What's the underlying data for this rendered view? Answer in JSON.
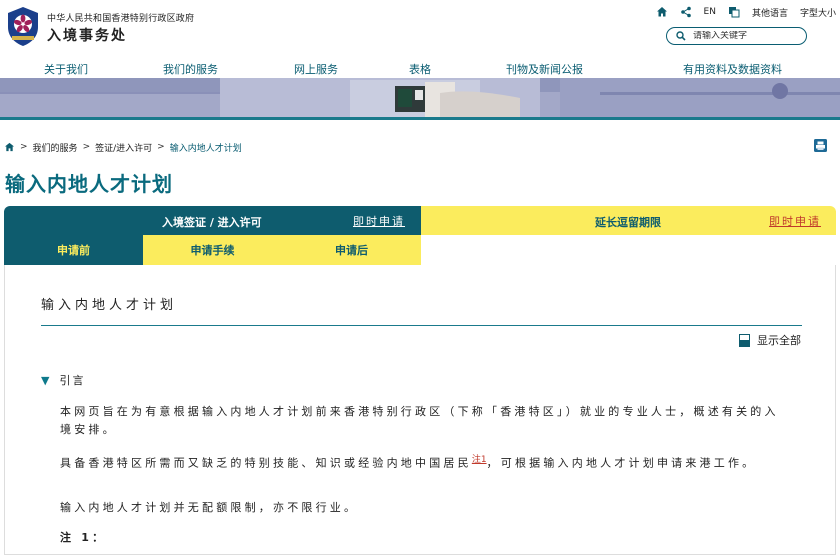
{
  "header": {
    "gov_name": "中华人民共和国香港特别行政区政府",
    "dept_name": "入境事务处",
    "utilities": {
      "en": "EN",
      "other_lang": "其他语言",
      "font_size": "字型大小"
    },
    "search": {
      "placeholder": "请输入关键字"
    }
  },
  "nav": {
    "items": [
      "关于我们",
      "我们的服务",
      "网上服务",
      "表格",
      "刊物及新闻公报",
      "有用资料及数据资料"
    ]
  },
  "breadcrumb": {
    "items": [
      "我们的服务",
      "签证/进入许可",
      "输入内地人才计划"
    ]
  },
  "page_title": "输入内地人才计划",
  "tabs": {
    "left_label": "入境签证 / 进入许可",
    "left_link": "即时申请",
    "right_label": "延长逗留期限",
    "right_link": "即时申请",
    "subtabs": [
      "申请前",
      "申请手续",
      "申请后"
    ]
  },
  "content": {
    "section_title": "输入内地人才计划",
    "show_all": "显示全部",
    "intro_heading": "引言",
    "para1": "本网页旨在为有意根据输入内地人才计划前来香港特别行政区（下称「香港特区」）就业的专业人士，概述有关的入境安排。",
    "para2a": "具备香港特区所需而又缺乏的特别技能、知识或经验内地中国居民",
    "para2_note": "注1",
    "para2b": "，可根据输入内地人才计划申请来港工作。",
    "para3": "输入内地人才计划并无配额限制，亦不限行业。",
    "note_label": "注 1："
  },
  "colors": {
    "brand_teal": "#0e5c6e",
    "accent_yellow": "#fbec5d",
    "link_red": "#c0392b",
    "title_teal": "#0a6a7e"
  }
}
